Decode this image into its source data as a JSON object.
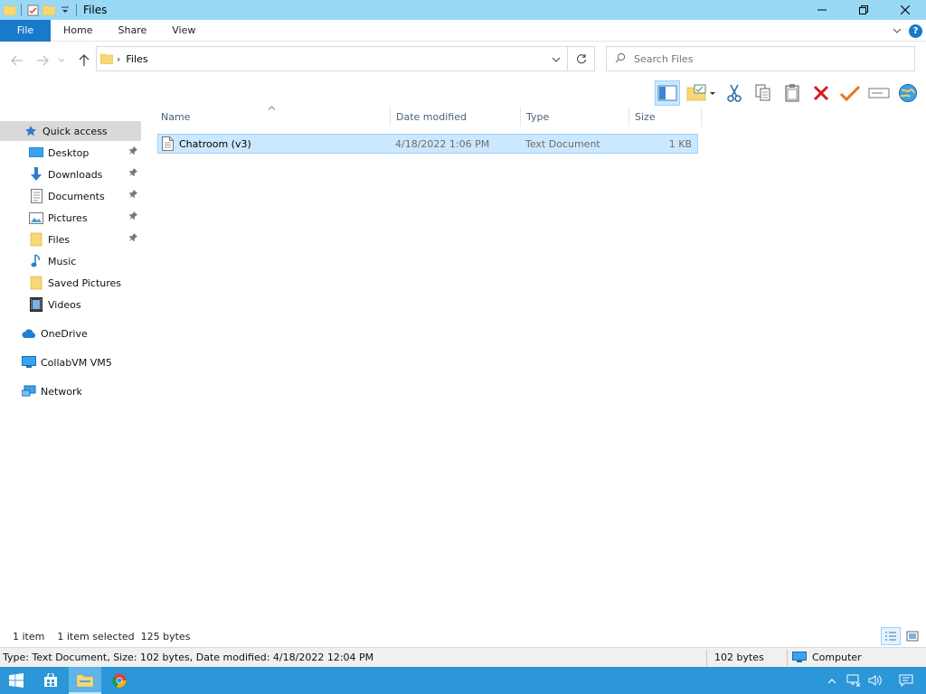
{
  "window": {
    "title": "Files"
  },
  "ribbon": {
    "tabs": [
      "File",
      "Home",
      "Share",
      "View"
    ]
  },
  "address": {
    "crumb_sep": "›",
    "crumb": "Files"
  },
  "search": {
    "placeholder": "Search Files"
  },
  "sidebar": {
    "quick_access": "Quick access",
    "items": [
      {
        "label": "Desktop",
        "icon": "desktop-icon",
        "pinned": true
      },
      {
        "label": "Downloads",
        "icon": "downloads-icon",
        "pinned": true
      },
      {
        "label": "Documents",
        "icon": "documents-icon",
        "pinned": true
      },
      {
        "label": "Pictures",
        "icon": "pictures-icon",
        "pinned": true
      },
      {
        "label": "Files",
        "icon": "folder-icon",
        "pinned": true
      },
      {
        "label": "Music",
        "icon": "music-icon",
        "pinned": false
      },
      {
        "label": "Saved Pictures",
        "icon": "folder-icon",
        "pinned": false
      },
      {
        "label": "Videos",
        "icon": "videos-icon",
        "pinned": false
      }
    ],
    "onedrive": "OneDrive",
    "computer": "CollabVM VM5",
    "network": "Network"
  },
  "columns": {
    "name": "Name",
    "date": "Date modified",
    "type": "Type",
    "size": "Size"
  },
  "files": [
    {
      "name": "Chatroom (v3)",
      "date": "4/18/2022 1:06 PM",
      "type": "Text Document",
      "size": "1 KB"
    }
  ],
  "status": {
    "count": "1 item",
    "selected": "1 item selected  125 bytes"
  },
  "details": {
    "summary": "Type: Text Document, Size: 102 bytes, Date modified: 4/18/2022 12:04 PM",
    "size": "102 bytes",
    "location": "Computer"
  },
  "colors": {
    "accent": "#1979ca",
    "selection": "#cce8ff",
    "selection_border": "#99d1ff",
    "titlebar": "#99d9f6",
    "taskbar": "#2b96d8"
  }
}
